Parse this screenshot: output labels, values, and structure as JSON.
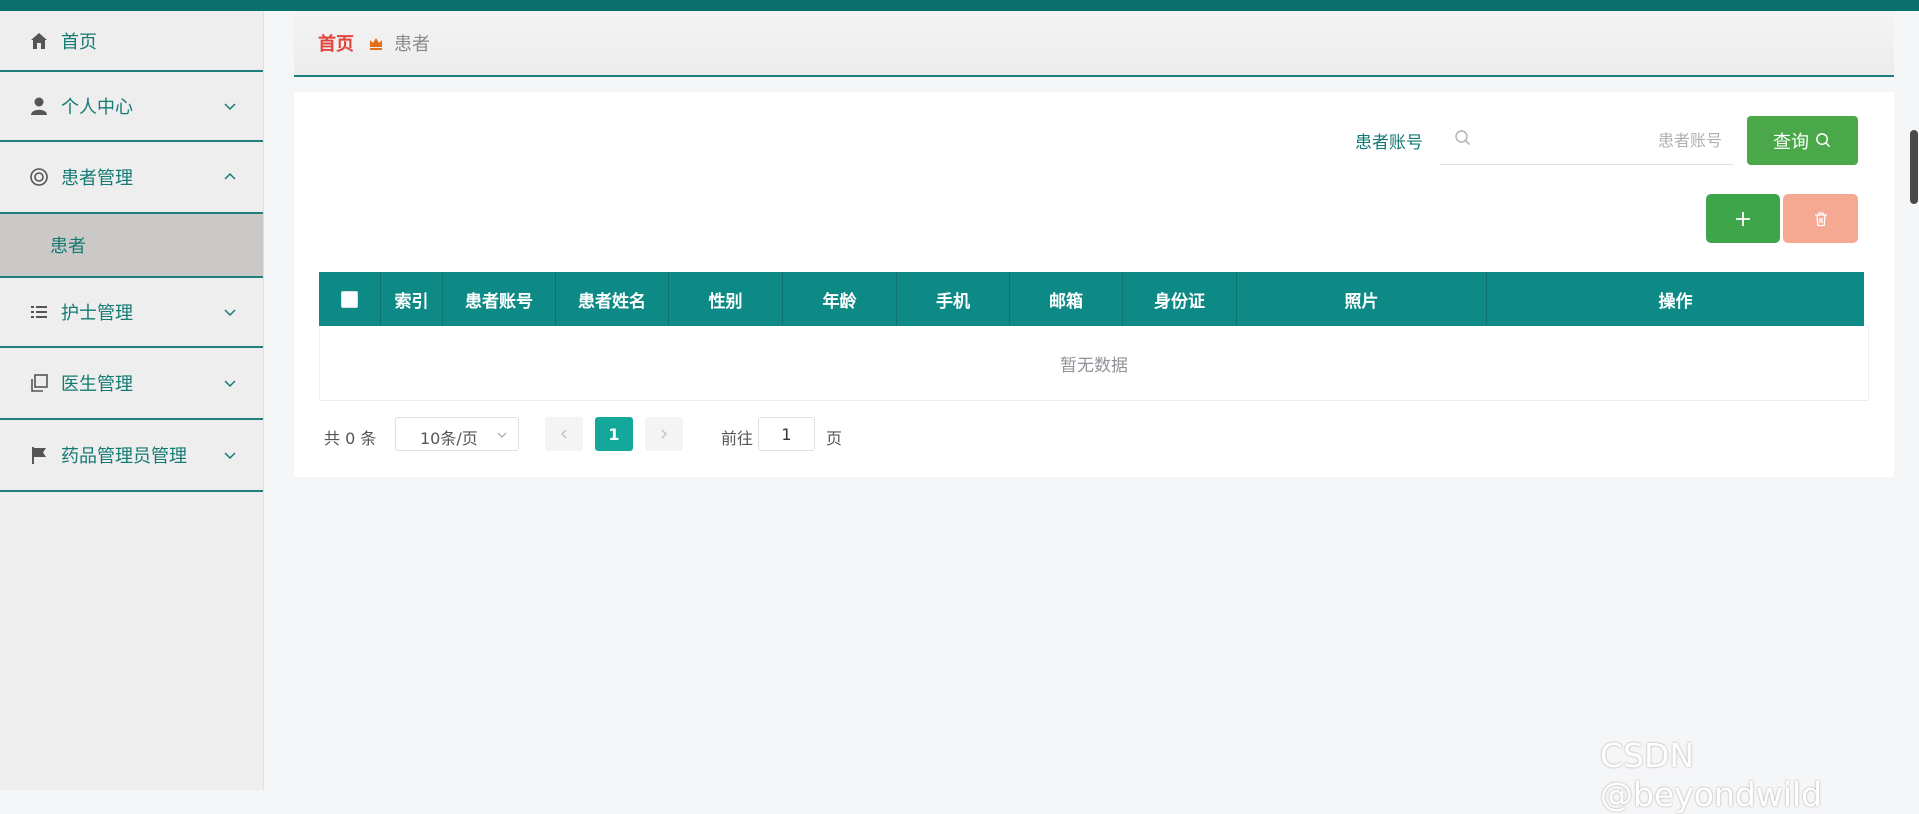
{
  "sidebar": {
    "items": [
      {
        "label": "首页",
        "icon": "home-icon",
        "has_arrow": false
      },
      {
        "label": "个人中心",
        "icon": "user-icon",
        "has_arrow": true
      },
      {
        "label": "患者管理",
        "icon": "lifebuoy-icon",
        "has_arrow": true,
        "expanded": true
      },
      {
        "label": "护士管理",
        "icon": "list-icon",
        "has_arrow": true
      },
      {
        "label": "医生管理",
        "icon": "copy-icon",
        "has_arrow": true
      },
      {
        "label": "药品管理员管理",
        "icon": "flag-icon",
        "has_arrow": true
      }
    ],
    "submenu": {
      "label": "患者"
    }
  },
  "breadcrumb": {
    "home": "首页",
    "current": "患者"
  },
  "search": {
    "label": "患者账号",
    "placeholder": "患者账号",
    "value": "",
    "button": "查询"
  },
  "toolbar": {
    "add_icon": "plus-icon",
    "delete_icon": "trash-icon"
  },
  "table": {
    "columns": [
      "索引",
      "患者账号",
      "患者姓名",
      "性别",
      "年龄",
      "手机",
      "邮箱",
      "身份证",
      "照片",
      "操作"
    ],
    "empty_text": "暂无数据"
  },
  "pagination": {
    "total": "共 0 条",
    "page_size": "10条/页",
    "current_page": "1",
    "goto_label": "前往",
    "goto_value": "1",
    "page_suffix": "页"
  },
  "watermark": "CSDN @beyondwild",
  "colors": {
    "primary": "#0e8a86",
    "accent_text": "#157a73",
    "query_button": "#4aa84a",
    "delete_button": "#f5a992",
    "home_link": "#e0443d"
  }
}
